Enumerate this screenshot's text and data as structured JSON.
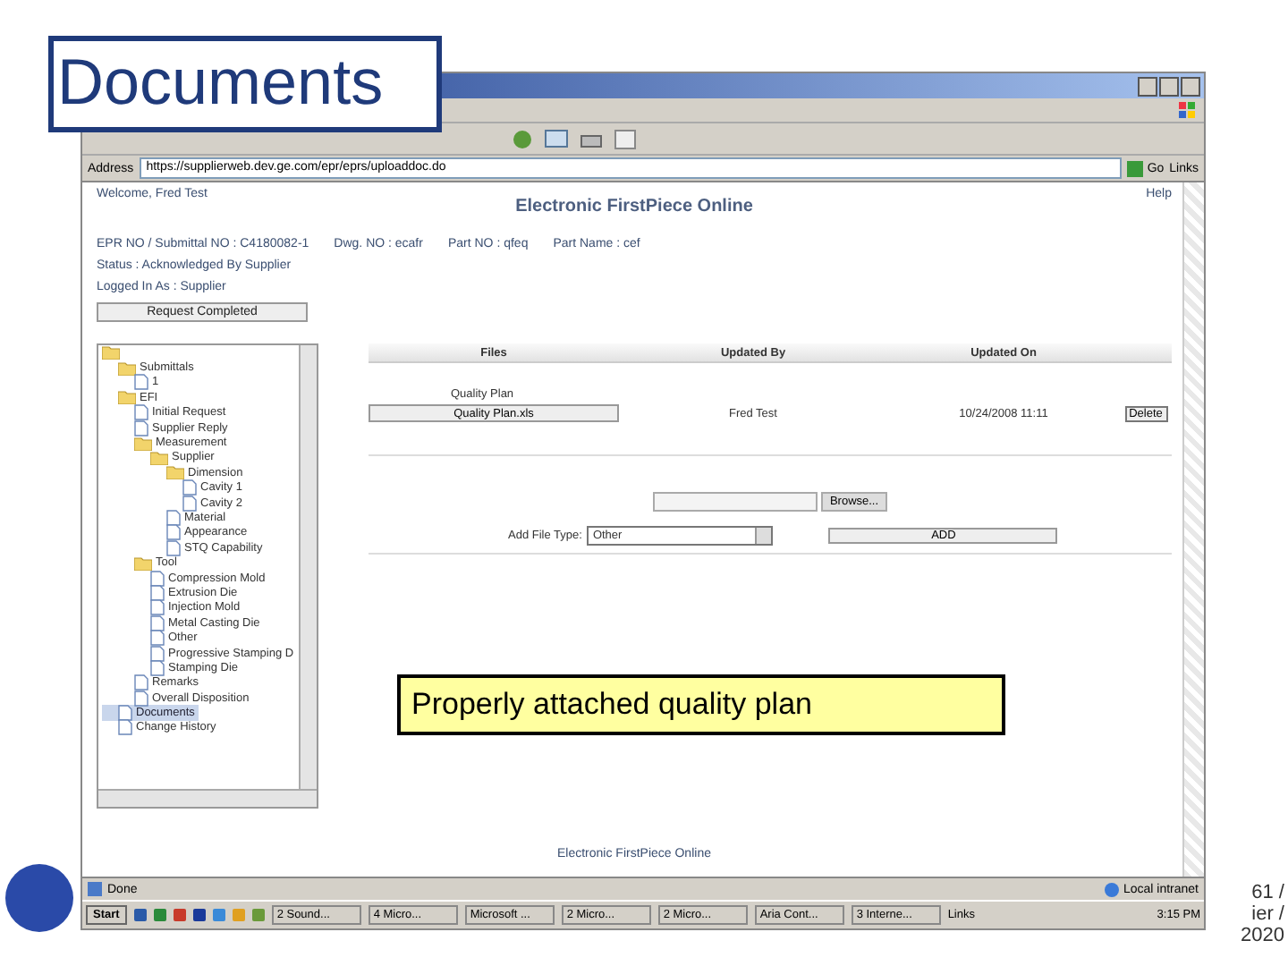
{
  "slide": {
    "title": "Documents",
    "callout": "Properly attached quality plan",
    "footer": [
      "61 /",
      "ier /",
      "2020"
    ]
  },
  "browser": {
    "address_label": "Address",
    "url": "https://supplierweb.dev.ge.com/epr/eprs/uploaddoc.do",
    "go": "Go",
    "links": "Links"
  },
  "page": {
    "welcome": "Welcome, Fred Test",
    "title": "Electronic FirstPiece Online",
    "help": "Help",
    "info": [
      [
        "EPR NO / Submittal NO : C4180082-1",
        "Dwg. NO : ecafr",
        "Part NO : qfeq",
        "Part Name : cef"
      ],
      [
        "Status : Acknowledged By Supplier"
      ],
      [
        "Logged In As : Supplier"
      ]
    ],
    "request_button": "Request Completed",
    "tree": [
      {
        "kind": "folder",
        "selected": false,
        "children": [
          {
            "kind": "folder",
            "label": "Submittals",
            "selected": false,
            "children": [
              {
                "kind": "doc",
                "label": "1",
                "selected": false
              }
            ]
          },
          {
            "kind": "folder",
            "label": "EFI",
            "selected": false,
            "children": [
              {
                "kind": "doc",
                "label": "Initial Request",
                "selected": false
              },
              {
                "kind": "doc",
                "label": "Supplier Reply",
                "selected": false
              },
              {
                "kind": "folder",
                "label": "Measurement",
                "selected": false,
                "children": [
                  {
                    "kind": "folder",
                    "label": "Supplier",
                    "selected": false,
                    "children": [
                      {
                        "kind": "folder",
                        "label": "Dimension",
                        "selected": false,
                        "children": [
                          {
                            "kind": "doc",
                            "label": "Cavity 1",
                            "selected": false
                          },
                          {
                            "kind": "doc",
                            "label": "Cavity 2",
                            "selected": false
                          }
                        ]
                      },
                      {
                        "kind": "doc",
                        "label": "Material",
                        "selected": false
                      },
                      {
                        "kind": "doc",
                        "label": "Appearance",
                        "selected": false
                      },
                      {
                        "kind": "doc",
                        "label": "STQ Capability",
                        "selected": false
                      }
                    ]
                  }
                ]
              },
              {
                "kind": "folder",
                "label": "Tool",
                "selected": false,
                "children": [
                  {
                    "kind": "doc",
                    "label": "Compression Mold",
                    "selected": false
                  },
                  {
                    "kind": "doc",
                    "label": "Extrusion Die",
                    "selected": false
                  },
                  {
                    "kind": "doc",
                    "label": "Injection Mold",
                    "selected": false
                  },
                  {
                    "kind": "doc",
                    "label": "Metal Casting Die",
                    "selected": false
                  },
                  {
                    "kind": "doc",
                    "label": "Other",
                    "selected": false
                  },
                  {
                    "kind": "doc",
                    "label": "Progressive Stamping D",
                    "selected": false
                  },
                  {
                    "kind": "doc",
                    "label": "Stamping Die",
                    "selected": false
                  }
                ]
              },
              {
                "kind": "doc",
                "label": "Remarks",
                "selected": false
              },
              {
                "kind": "doc",
                "label": "Overall Disposition",
                "selected": false
              }
            ]
          },
          {
            "kind": "doc",
            "label": "Documents",
            "selected": true
          },
          {
            "kind": "doc",
            "label": "Change History",
            "selected": false
          }
        ]
      }
    ],
    "table": {
      "columns": [
        "Files",
        "Updated By",
        "Updated On"
      ],
      "rows": [
        {
          "type_label": "Quality Plan",
          "file": "Quality Plan.xls",
          "updated_by": "Fred Test",
          "updated_on": "10/24/2008 11:11",
          "action": "Delete"
        }
      ]
    },
    "browse_button": "Browse...",
    "file_type_label": "Add File Type:",
    "file_type": "Other",
    "add_button": "ADD",
    "footer": "Electronic FirstPiece Online"
  },
  "status_bar": {
    "text": "Done",
    "zone": "Local intranet"
  },
  "taskbar": {
    "start": "Start",
    "tasks": [
      "2 Sound...",
      "4 Micro...",
      "Microsoft ...",
      "2 Micro...",
      "2 Micro...",
      "Aria Cont...",
      "3 Interne..."
    ],
    "links": "Links",
    "clock": "3:15 PM"
  }
}
